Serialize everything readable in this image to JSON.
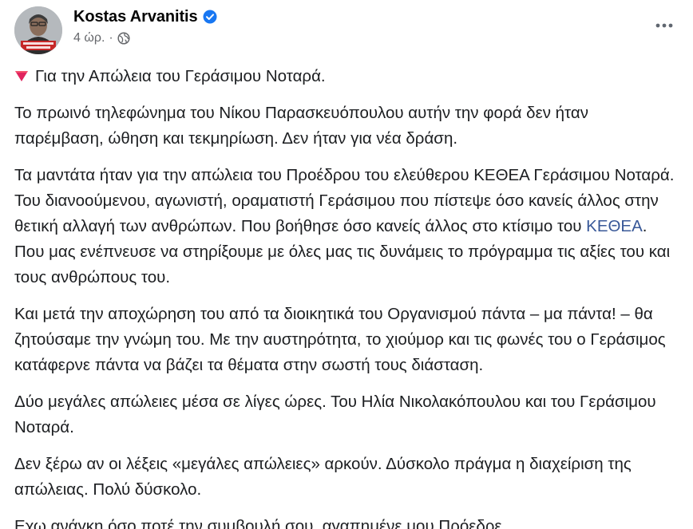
{
  "author": {
    "name": "Kostas Arvanitis",
    "verified": true,
    "time": "4 ώρ.",
    "separator": "·",
    "audience_icon": "globe-icon",
    "avatar_icon": "avatar-photo"
  },
  "menu": {
    "more_icon": "more-horizontal-icon"
  },
  "post": {
    "p1_text": "Για την Απώλεια του Γεράσιμου Νοταρά.",
    "p1_icon": "red-triangle-down-icon",
    "p2": "Το πρωινό τηλεφώνημα του Νίκου Παρασκευόπουλου αυτήν την φορά δεν ήταν παρέμβαση, ώθηση και τεκμηρίωση. Δεν ήταν για νέα δράση.",
    "p3_before_link": "Τα μαντάτα ήταν για την απώλεια του Προέδρου του ελεύθερου ΚΕΘΕΑ Γεράσιμου Νοταρά. Του διανοούμενου, αγωνιστή, οραματιστή Γεράσιμου που πίστεψε όσο κανείς άλλος στην θετική αλλαγή των ανθρώπων. Που βοήθησε όσο κανείς άλλος στο κτίσιμο του ",
    "p3_link": "ΚΕΘΕΑ",
    "p3_after_link": ". Που μας ενέπνευσε να στηρίξουμε με όλες μας τις δυνάμεις το πρόγραμμα τις αξίες του και τους ανθρώπους του.",
    "p4": "Και μετά την αποχώρηση του από τα διοικητικά του Οργανισμού πάντα – μα πάντα! – θα ζητούσαμε την γνώμη του. Με την  αυστηρότητα, το χιούμορ και τις φωνές του ο Γεράσιμος κατάφερνε πάντα να βάζει τα θέματα στην σωστή τους διάσταση.",
    "p5": "Δύο μεγάλες απώλειες μέσα σε λίγες ώρες. Του Ηλία Νικολακόπουλου και του Γεράσιμου Νοταρά.",
    "p6": "Δεν ξέρω αν οι λέξεις «μεγάλες απώλειες» αρκούν. Δύσκολο πράγμα η διαχείριση της απώλειας. Πολύ δύσκολο.",
    "p7": "Εχω ανάγκη όσο ποτέ την συμβουλή σου, αγαπημένε μου Πρόεδρε..."
  },
  "colors": {
    "link": "#385898",
    "verified": "#1877f2",
    "secondary_text": "#65676b",
    "red_triangle": "#e0245e"
  }
}
